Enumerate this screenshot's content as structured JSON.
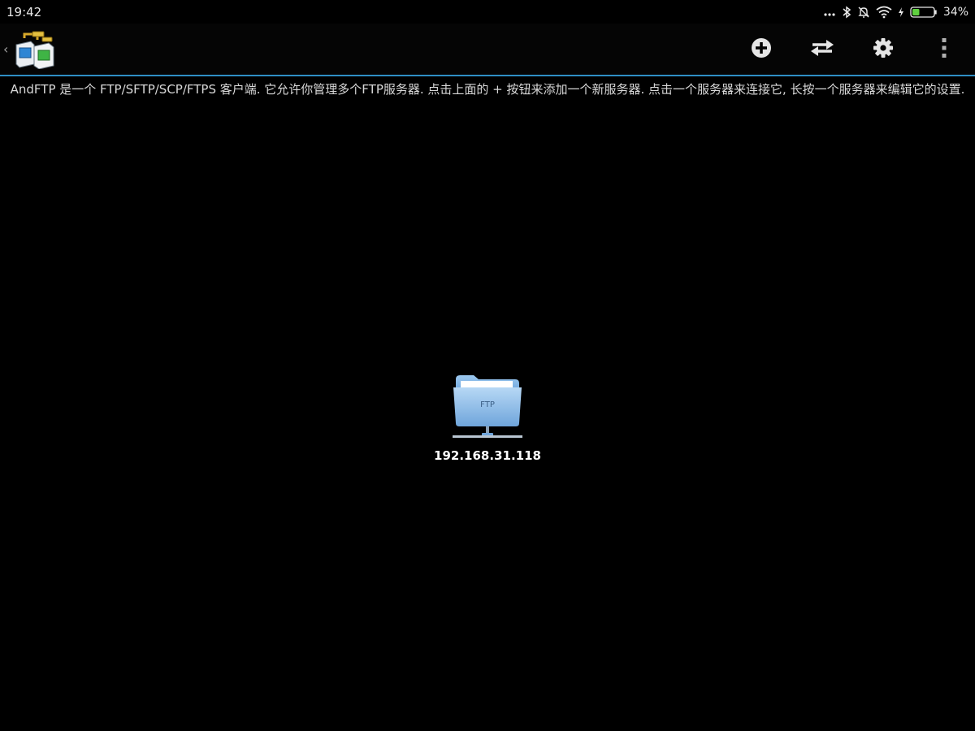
{
  "status_bar": {
    "time": "19:42",
    "battery_percent": "34%",
    "battery_level": 0.34,
    "icons": [
      "more-icon",
      "bluetooth-icon",
      "alarm-off-icon",
      "wifi-icon",
      "charging-icon",
      "battery-icon"
    ]
  },
  "action_bar": {
    "icons": [
      "app-logo-icon",
      "add-server-icon",
      "transfer-icon",
      "settings-icon",
      "overflow-menu-icon"
    ],
    "accent_color": "#2f8fc4"
  },
  "main": {
    "description": "AndFTP 是一个 FTP/SFTP/SCP/FTPS 客户端. 它允许你管理多个FTP服务器. 点击上面的 + 按钮来添加一个新服务器. 点击一个服务器来连接它, 长按一个服务器来编辑它的设置.",
    "servers": [
      {
        "label": "192.168.31.118",
        "icon_text": "FTP",
        "icon": "ftp-folder-icon"
      }
    ]
  }
}
